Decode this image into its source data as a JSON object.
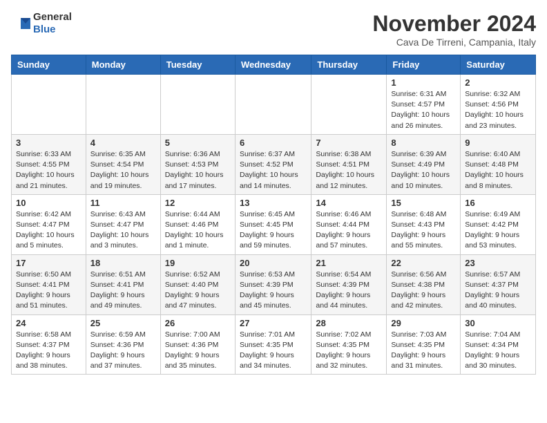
{
  "logo": {
    "general": "General",
    "blue": "Blue"
  },
  "title": "November 2024",
  "subtitle": "Cava De Tirreni, Campania, Italy",
  "headers": [
    "Sunday",
    "Monday",
    "Tuesday",
    "Wednesday",
    "Thursday",
    "Friday",
    "Saturday"
  ],
  "rows": [
    [
      {
        "day": "",
        "detail": ""
      },
      {
        "day": "",
        "detail": ""
      },
      {
        "day": "",
        "detail": ""
      },
      {
        "day": "",
        "detail": ""
      },
      {
        "day": "",
        "detail": ""
      },
      {
        "day": "1",
        "detail": "Sunrise: 6:31 AM\nSunset: 4:57 PM\nDaylight: 10 hours and 26 minutes."
      },
      {
        "day": "2",
        "detail": "Sunrise: 6:32 AM\nSunset: 4:56 PM\nDaylight: 10 hours and 23 minutes."
      }
    ],
    [
      {
        "day": "3",
        "detail": "Sunrise: 6:33 AM\nSunset: 4:55 PM\nDaylight: 10 hours and 21 minutes."
      },
      {
        "day": "4",
        "detail": "Sunrise: 6:35 AM\nSunset: 4:54 PM\nDaylight: 10 hours and 19 minutes."
      },
      {
        "day": "5",
        "detail": "Sunrise: 6:36 AM\nSunset: 4:53 PM\nDaylight: 10 hours and 17 minutes."
      },
      {
        "day": "6",
        "detail": "Sunrise: 6:37 AM\nSunset: 4:52 PM\nDaylight: 10 hours and 14 minutes."
      },
      {
        "day": "7",
        "detail": "Sunrise: 6:38 AM\nSunset: 4:51 PM\nDaylight: 10 hours and 12 minutes."
      },
      {
        "day": "8",
        "detail": "Sunrise: 6:39 AM\nSunset: 4:49 PM\nDaylight: 10 hours and 10 minutes."
      },
      {
        "day": "9",
        "detail": "Sunrise: 6:40 AM\nSunset: 4:48 PM\nDaylight: 10 hours and 8 minutes."
      }
    ],
    [
      {
        "day": "10",
        "detail": "Sunrise: 6:42 AM\nSunset: 4:47 PM\nDaylight: 10 hours and 5 minutes."
      },
      {
        "day": "11",
        "detail": "Sunrise: 6:43 AM\nSunset: 4:47 PM\nDaylight: 10 hours and 3 minutes."
      },
      {
        "day": "12",
        "detail": "Sunrise: 6:44 AM\nSunset: 4:46 PM\nDaylight: 10 hours and 1 minute."
      },
      {
        "day": "13",
        "detail": "Sunrise: 6:45 AM\nSunset: 4:45 PM\nDaylight: 9 hours and 59 minutes."
      },
      {
        "day": "14",
        "detail": "Sunrise: 6:46 AM\nSunset: 4:44 PM\nDaylight: 9 hours and 57 minutes."
      },
      {
        "day": "15",
        "detail": "Sunrise: 6:48 AM\nSunset: 4:43 PM\nDaylight: 9 hours and 55 minutes."
      },
      {
        "day": "16",
        "detail": "Sunrise: 6:49 AM\nSunset: 4:42 PM\nDaylight: 9 hours and 53 minutes."
      }
    ],
    [
      {
        "day": "17",
        "detail": "Sunrise: 6:50 AM\nSunset: 4:41 PM\nDaylight: 9 hours and 51 minutes."
      },
      {
        "day": "18",
        "detail": "Sunrise: 6:51 AM\nSunset: 4:41 PM\nDaylight: 9 hours and 49 minutes."
      },
      {
        "day": "19",
        "detail": "Sunrise: 6:52 AM\nSunset: 4:40 PM\nDaylight: 9 hours and 47 minutes."
      },
      {
        "day": "20",
        "detail": "Sunrise: 6:53 AM\nSunset: 4:39 PM\nDaylight: 9 hours and 45 minutes."
      },
      {
        "day": "21",
        "detail": "Sunrise: 6:54 AM\nSunset: 4:39 PM\nDaylight: 9 hours and 44 minutes."
      },
      {
        "day": "22",
        "detail": "Sunrise: 6:56 AM\nSunset: 4:38 PM\nDaylight: 9 hours and 42 minutes."
      },
      {
        "day": "23",
        "detail": "Sunrise: 6:57 AM\nSunset: 4:37 PM\nDaylight: 9 hours and 40 minutes."
      }
    ],
    [
      {
        "day": "24",
        "detail": "Sunrise: 6:58 AM\nSunset: 4:37 PM\nDaylight: 9 hours and 38 minutes."
      },
      {
        "day": "25",
        "detail": "Sunrise: 6:59 AM\nSunset: 4:36 PM\nDaylight: 9 hours and 37 minutes."
      },
      {
        "day": "26",
        "detail": "Sunrise: 7:00 AM\nSunset: 4:36 PM\nDaylight: 9 hours and 35 minutes."
      },
      {
        "day": "27",
        "detail": "Sunrise: 7:01 AM\nSunset: 4:35 PM\nDaylight: 9 hours and 34 minutes."
      },
      {
        "day": "28",
        "detail": "Sunrise: 7:02 AM\nSunset: 4:35 PM\nDaylight: 9 hours and 32 minutes."
      },
      {
        "day": "29",
        "detail": "Sunrise: 7:03 AM\nSunset: 4:35 PM\nDaylight: 9 hours and 31 minutes."
      },
      {
        "day": "30",
        "detail": "Sunrise: 7:04 AM\nSunset: 4:34 PM\nDaylight: 9 hours and 30 minutes."
      }
    ]
  ]
}
